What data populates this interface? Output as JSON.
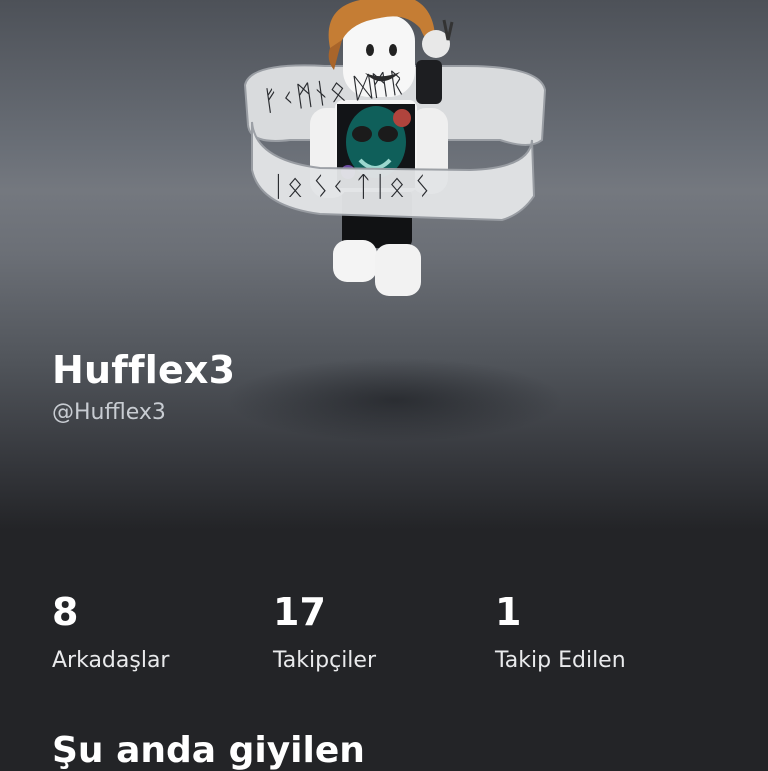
{
  "profile": {
    "display_name": "Hufflex3",
    "username": "@Hufflex3",
    "avatar_runes_top": "ᚠᚲᛗᚾᛟ ᛞᛗᚱ",
    "avatar_runes_bottom": "ᛁᛟ ᛊᚲ ᛏᛁᛟ ᛊ"
  },
  "stats": [
    {
      "count": "8",
      "label": "Arkadaşlar"
    },
    {
      "count": "17",
      "label": "Takipçiler"
    },
    {
      "count": "1",
      "label": "Takip Edilen"
    }
  ],
  "sections": {
    "currently_wearing": "Şu anda giyilen"
  }
}
